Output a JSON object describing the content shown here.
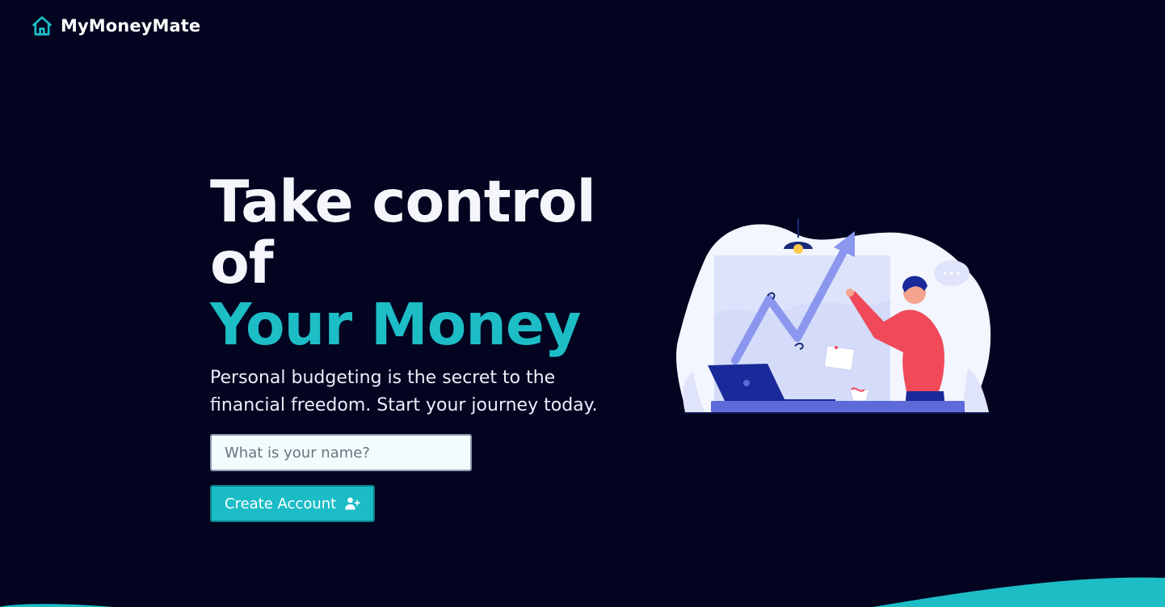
{
  "brand": {
    "name": "MyMoneyMate",
    "icon": "home-icon",
    "accent": "#1dbdc6"
  },
  "hero": {
    "headline_line1": "Take control of",
    "headline_line2": "Your Money",
    "tagline": "Personal budgeting is the secret to the financial freedom. Start your journey today."
  },
  "form": {
    "name_placeholder": "What is your name?",
    "name_value": "",
    "submit_label": "Create Account",
    "submit_icon": "user-plus-icon"
  },
  "colors": {
    "background": "#020420",
    "accent": "#1dbdc6",
    "illustration_person_shirt": "#f04a5a",
    "illustration_chart": "#8b96ee"
  }
}
